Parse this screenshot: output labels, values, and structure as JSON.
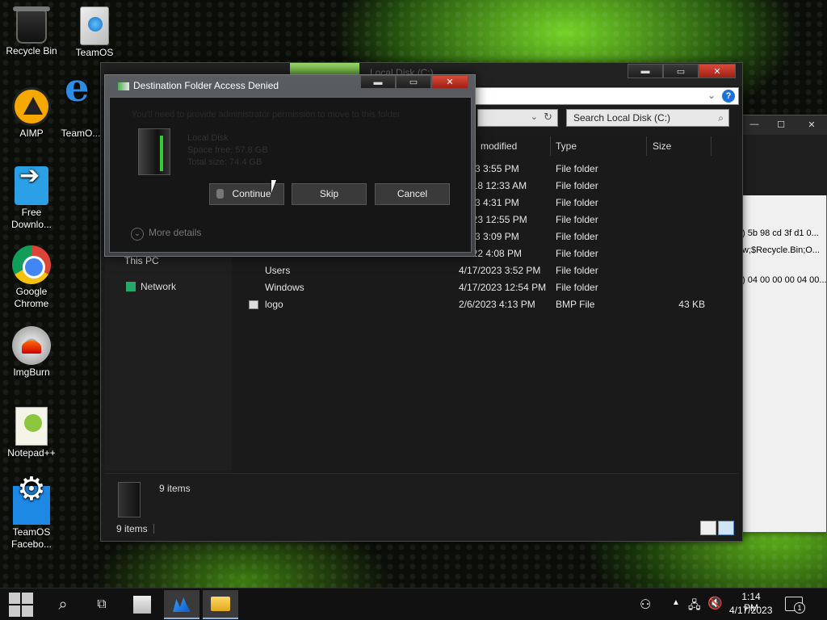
{
  "desktop": {
    "icons": [
      {
        "label": "Recycle Bin",
        "icon": "recycle-bin-icon"
      },
      {
        "label": "TeamOS",
        "icon": "teamos-icon"
      },
      {
        "label": "AIMP",
        "icon": "aimp-icon"
      },
      {
        "label": "TeamO...",
        "icon": "ie-icon"
      },
      {
        "label": "Free Downlo...",
        "icon": "free-download-icon"
      },
      {
        "label": "Google Chrome",
        "icon": "chrome-icon"
      },
      {
        "label": "ImgBurn",
        "icon": "imgburn-icon"
      },
      {
        "label": "Notepad++",
        "icon": "notepadpp-icon"
      },
      {
        "label": "TeamOS Facebo...",
        "icon": "gear-icon"
      }
    ]
  },
  "explorer": {
    "title": "Local Disk (C:)",
    "search_placeholder": "Search Local Disk (C:)",
    "columns": {
      "modified": "modified",
      "type": "Type",
      "size": "Size"
    },
    "rows": [
      {
        "name": "",
        "modified": "2023 3:55 PM",
        "type": "File folder",
        "size": ""
      },
      {
        "name": "",
        "modified": "/2018 12:33 AM",
        "type": "File folder",
        "size": ""
      },
      {
        "name": "",
        "modified": "2023 4:31 PM",
        "type": "File folder",
        "size": ""
      },
      {
        "name": "",
        "modified": "/2023 12:55 PM",
        "type": "File folder",
        "size": ""
      },
      {
        "name": "",
        "modified": "2023 3:09 PM",
        "type": "File folder",
        "size": ""
      },
      {
        "name": "",
        "modified": "/2022 4:08 PM",
        "type": "File folder",
        "size": ""
      },
      {
        "name": "Users",
        "modified": "4/17/2023 3:52 PM",
        "type": "File folder",
        "size": ""
      },
      {
        "name": "Windows",
        "modified": "4/17/2023 12:54 PM",
        "type": "File folder",
        "size": ""
      },
      {
        "name": "logo",
        "modified": "2/6/2023 4:13 PM",
        "type": "BMP File",
        "size": "43 KB"
      }
    ],
    "nav": {
      "this_pc": "This PC",
      "network": "Network"
    },
    "details_count": "9 items",
    "status_count": "9 items"
  },
  "background_window": {
    "lines": [
      ") 5b 98 cd 3f d1 0...",
      "w;$Recycle.Bin;O...",
      ") 04 00 00 00 04 00..."
    ]
  },
  "dialog": {
    "title": "Destination Folder Access Denied",
    "message": "You'll need to provide administrator permission to move to this folder",
    "drive_name": "Local Disk",
    "space_free": "Space free: 57.8 GB",
    "total_size": "Total size: 74.4 GB",
    "continue_label": "Continue",
    "skip_label": "Skip",
    "cancel_label": "Cancel",
    "more_details": "More details"
  },
  "taskbar": {
    "time": "1:14 PM",
    "date": "4/17/2023",
    "notification_count": "1"
  }
}
